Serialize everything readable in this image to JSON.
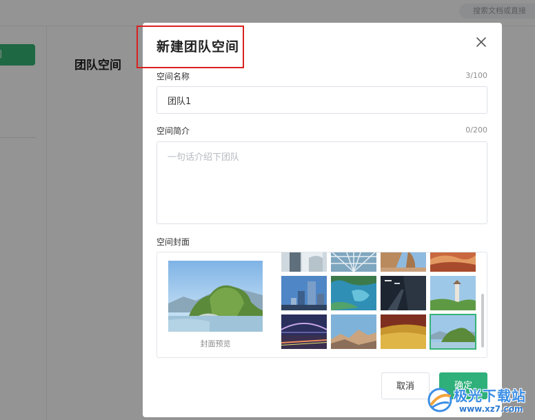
{
  "background": {
    "search_placeholder": "搜索文档或直接",
    "sidebar_button_label": "间",
    "page_title": "团队空间"
  },
  "modal": {
    "title": "新建团队空间",
    "name_field": {
      "label": "空间名称",
      "value": "团队1",
      "counter": "3/100"
    },
    "intro_field": {
      "label": "空间简介",
      "placeholder": "一句话介绍下团队",
      "counter": "0/200"
    },
    "cover": {
      "label": "空间封面",
      "preview_label": "封面预览",
      "thumbnails": [
        {
          "name": "glass-building"
        },
        {
          "name": "glass-dome"
        },
        {
          "name": "rock-arch"
        },
        {
          "name": "red-canyon"
        },
        {
          "name": "city-skyscraper"
        },
        {
          "name": "aerial-lake"
        },
        {
          "name": "dark-corridor"
        },
        {
          "name": "tower-pagoda"
        },
        {
          "name": "night-bridge"
        },
        {
          "name": "mountain-sunset"
        },
        {
          "name": "wheat-field"
        },
        {
          "name": "karst-river",
          "selected": true
        }
      ]
    },
    "buttons": {
      "cancel": "取消",
      "ok": "确定"
    }
  },
  "watermark": {
    "text": "极光下载站",
    "url": "www.xz7.com"
  },
  "colors": {
    "accent": "#2fb07a",
    "highlight_border": "#d9201f"
  }
}
